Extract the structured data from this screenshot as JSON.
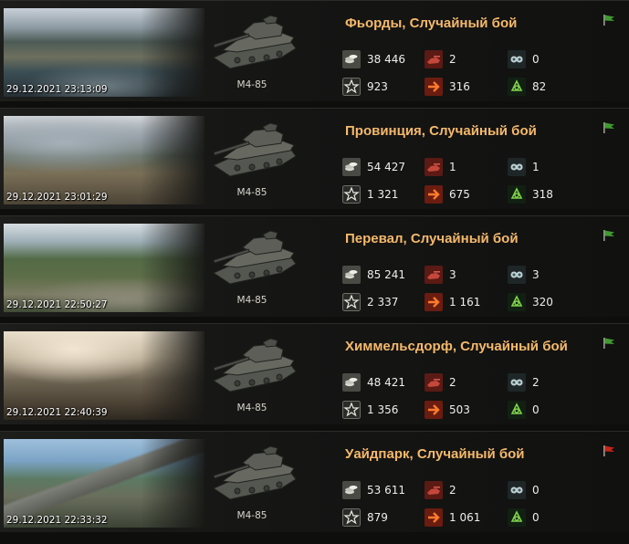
{
  "battles": [
    {
      "title": "Фьорды, Случайный бой",
      "datetime": "29.12.2021 23:13:09",
      "vehicle": "M4-85",
      "result": "victory",
      "credits": "38 446",
      "kills": "2",
      "assists": "0",
      "xp": "923",
      "damage": "316",
      "blocked": "82"
    },
    {
      "title": "Провинция, Случайный бой",
      "datetime": "29.12.2021 23:01:29",
      "vehicle": "M4-85",
      "result": "victory",
      "credits": "54 427",
      "kills": "1",
      "assists": "1",
      "xp": "1 321",
      "damage": "675",
      "blocked": "318"
    },
    {
      "title": "Перевал, Случайный бой",
      "datetime": "29.12.2021 22:50:27",
      "vehicle": "M4-85",
      "result": "victory",
      "credits": "85 241",
      "kills": "3",
      "assists": "3",
      "xp": "2 337",
      "damage": "1 161",
      "blocked": "320"
    },
    {
      "title": "Химмельсдорф, Случайный бой",
      "datetime": "29.12.2021 22:40:39",
      "vehicle": "M4-85",
      "result": "victory",
      "credits": "48 421",
      "kills": "2",
      "assists": "2",
      "xp": "1 356",
      "damage": "503",
      "blocked": "0"
    },
    {
      "title": "Уайдпарк, Случайный бой",
      "datetime": "29.12.2021 22:33:32",
      "vehicle": "M4-85",
      "result": "defeat",
      "credits": "53 611",
      "kills": "2",
      "assists": "0",
      "xp": "879",
      "damage": "1 061",
      "blocked": "0"
    }
  ],
  "colors": {
    "title": "#f5b96b",
    "victory_flag": "#3f9b2e",
    "defeat_flag": "#c42418",
    "text": "#eeeeea"
  },
  "icons": {
    "credits": "coins-icon",
    "kills": "destroyed-tank-icon",
    "assists": "spotting-icon",
    "xp": "star-icon",
    "damage": "damage-arrow-icon",
    "blocked": "blocked-damage-icon",
    "result": "flag-icon"
  }
}
